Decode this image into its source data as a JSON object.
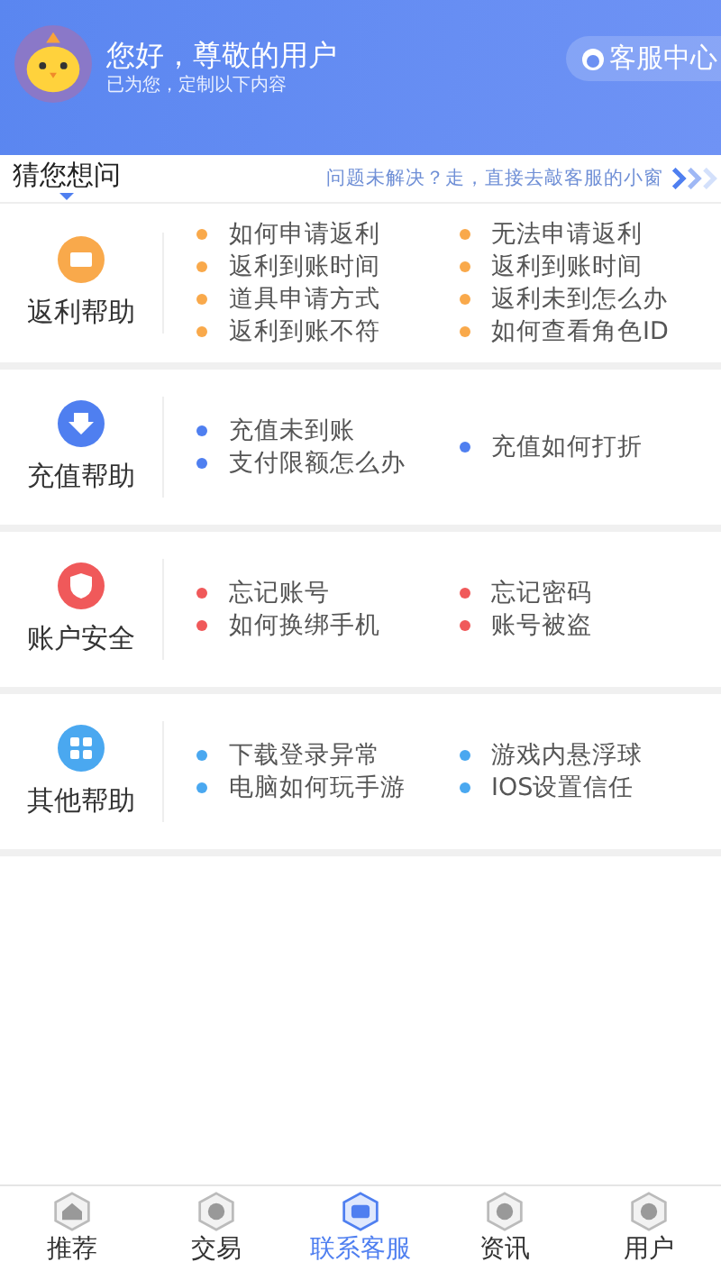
{
  "header": {
    "greeting": "您好，尊敬的用户",
    "subtitle": "已为您，定制以下内容",
    "service_button": "客服中心"
  },
  "guess": {
    "title": "猜您想问",
    "link": "问题未解决？走，直接去敲客服的小窗"
  },
  "categories": [
    {
      "kind": "rebate",
      "title": "返利帮助",
      "color": "#f9a94b",
      "left": [
        "如何申请返利",
        "返利到账时间",
        "道具申请方式",
        "返利到账不符"
      ],
      "right": [
        "无法申请返利",
        "返利到账时间",
        "返利未到怎么办",
        "如何查看角色ID"
      ]
    },
    {
      "kind": "recharge",
      "title": "充值帮助",
      "color": "#4f7ff0",
      "left": [
        "充值未到账",
        "支付限额怎么办"
      ],
      "right": [
        "充值如何打折"
      ]
    },
    {
      "kind": "security",
      "title": "账户安全",
      "color": "#f0595a",
      "left": [
        "忘记账号",
        "如何换绑手机"
      ],
      "right": [
        "忘记密码",
        "账号被盗"
      ]
    },
    {
      "kind": "other",
      "title": "其他帮助",
      "color": "#4aa8f0",
      "left": [
        "下载登录异常",
        "电脑如何玩手游"
      ],
      "right": [
        "游戏内悬浮球",
        "IOS设置信任"
      ]
    }
  ],
  "nav": [
    {
      "kind": "home",
      "label": "推荐",
      "selected": false
    },
    {
      "kind": "trade",
      "label": "交易",
      "selected": false
    },
    {
      "kind": "chat",
      "label": "联系客服",
      "selected": true
    },
    {
      "kind": "news",
      "label": "资讯",
      "selected": false
    },
    {
      "kind": "user",
      "label": "用户",
      "selected": false
    }
  ]
}
